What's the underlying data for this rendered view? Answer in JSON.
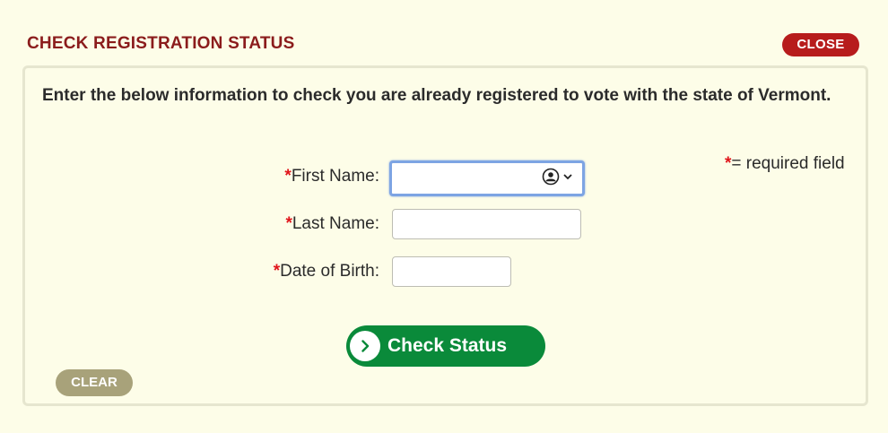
{
  "dialog": {
    "title": "CHECK REGISTRATION STATUS",
    "close_label": "CLOSE",
    "intro": "Enter the below information to check you are already registered to vote with the state of Vermont.",
    "required_note_star": "*",
    "required_note_text": "= required field"
  },
  "form": {
    "first_name": {
      "star": "*",
      "label": "First Name:",
      "value": ""
    },
    "last_name": {
      "star": "*",
      "label": "Last Name:",
      "value": ""
    },
    "dob": {
      "star": "*",
      "label": "Date of Birth:",
      "value": ""
    }
  },
  "buttons": {
    "check_status": "Check Status",
    "clear": "CLEAR"
  },
  "colors": {
    "title": "#8b1c1c",
    "close_bg": "#b71c1c",
    "check_bg": "#0a8a3a",
    "clear_bg": "#a8a27a",
    "required_star": "#e0141a"
  },
  "icons": {
    "autofill": "contact-autofill-icon",
    "check_arrow": "chevron-right-circle-icon"
  }
}
